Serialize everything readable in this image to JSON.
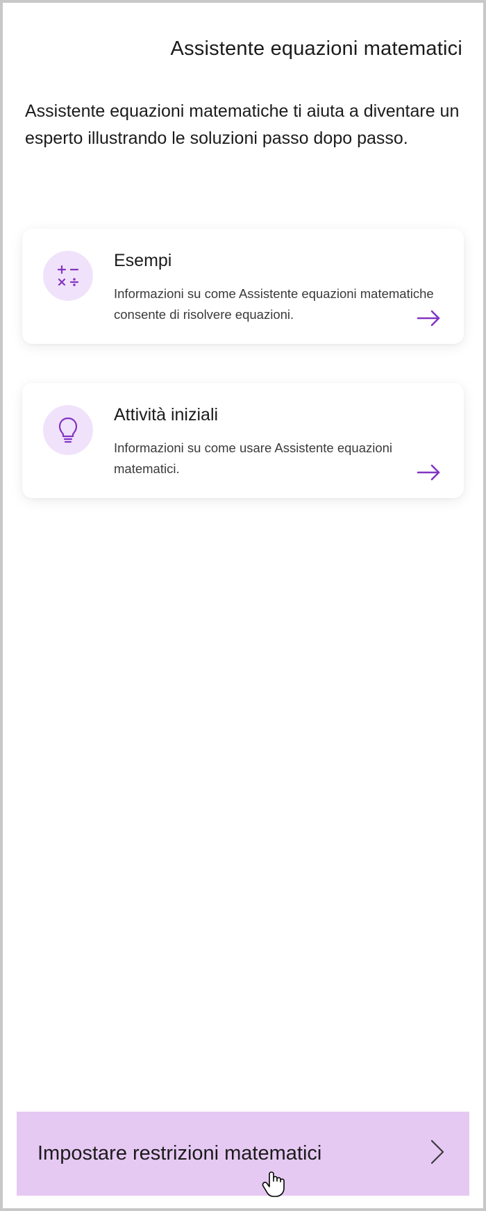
{
  "header": {
    "title": "Assistente equazioni matematici"
  },
  "description": "Assistente equazioni matematiche ti aiuta a diventare un esperto illustrando le soluzioni passo dopo passo.",
  "cards": [
    {
      "title": "Esempi",
      "desc": "Informazioni su come Assistente equazioni matematiche consente di risolvere equazioni.",
      "icon": "math-ops-icon"
    },
    {
      "title": "Attività iniziali",
      "desc": "Informazioni su come usare Assistente equazioni matematici.",
      "icon": "lightbulb-icon"
    }
  ],
  "footer": {
    "label": "Impostare restrizioni matematici"
  },
  "colors": {
    "accent": "#8a2be2",
    "accent_light": "#f0e2fb",
    "footer_bg": "#e6c9f3"
  }
}
